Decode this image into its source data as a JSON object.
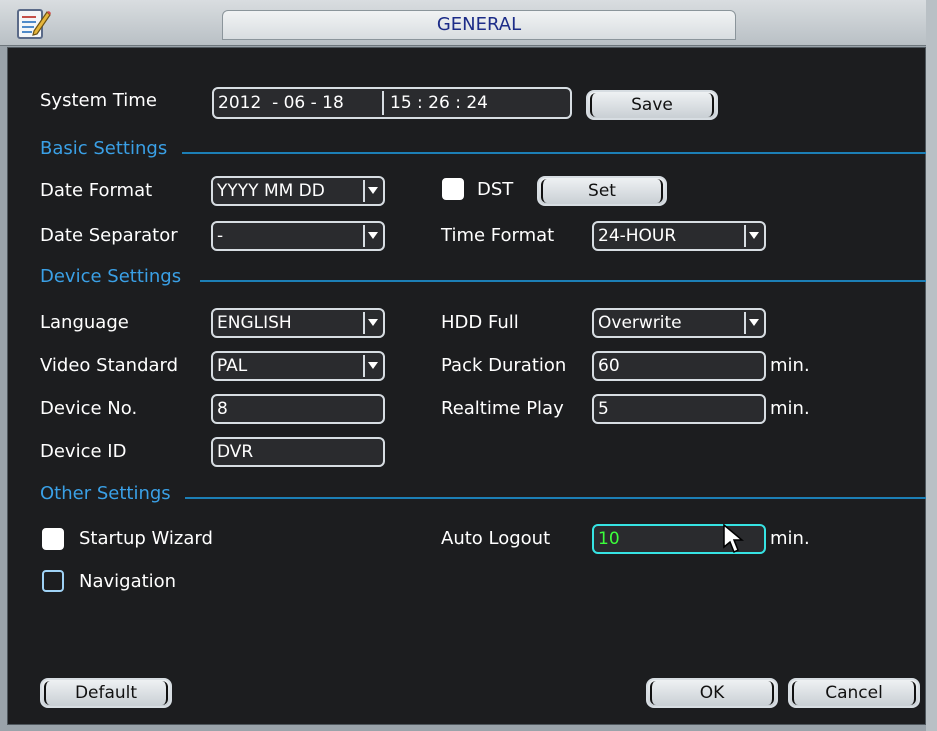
{
  "window": {
    "title": "GENERAL"
  },
  "system_time": {
    "label": "System Time",
    "date": "2012  - 06 - 18",
    "time": "15 : 26 : 24",
    "save_label": "Save"
  },
  "sections": {
    "basic": "Basic Settings",
    "device": "Device Settings",
    "other": "Other Settings"
  },
  "basic": {
    "date_format_label": "Date Format",
    "date_format_value": "YYYY MM DD",
    "dst_label": "DST",
    "dst_checked": false,
    "dst_set_label": "Set",
    "date_separator_label": "Date Separator",
    "date_separator_value": "-",
    "time_format_label": "Time Format",
    "time_format_value": "24-HOUR"
  },
  "device": {
    "language_label": "Language",
    "language_value": "ENGLISH",
    "hdd_full_label": "HDD Full",
    "hdd_full_value": "Overwrite",
    "video_standard_label": "Video Standard",
    "video_standard_value": "PAL",
    "pack_duration_label": "Pack Duration",
    "pack_duration_value": "60",
    "pack_duration_unit": "min.",
    "device_no_label": "Device No.",
    "device_no_value": "8",
    "realtime_play_label": "Realtime Play",
    "realtime_play_value": "5",
    "realtime_play_unit": "min.",
    "device_id_label": "Device ID",
    "device_id_value": "DVR"
  },
  "other": {
    "startup_wizard_label": "Startup Wizard",
    "startup_wizard_checked": false,
    "navigation_label": "Navigation",
    "navigation_checked": false,
    "auto_logout_label": "Auto Logout",
    "auto_logout_value": "10",
    "auto_logout_unit": "min."
  },
  "footer": {
    "default_label": "Default",
    "ok_label": "OK",
    "cancel_label": "Cancel"
  },
  "colors": {
    "section_text": "#3aa0e6",
    "section_line": "#1c7fb6",
    "panel_bg": "#1c1d1f",
    "title_text": "#1c2c88",
    "active_border": "#36e3e3",
    "active_value": "#3bff3b"
  },
  "icons": {
    "title": "notepad-pencil-icon",
    "dropdown": "chevron-down-icon",
    "cursor": "mouse-pointer-icon"
  }
}
